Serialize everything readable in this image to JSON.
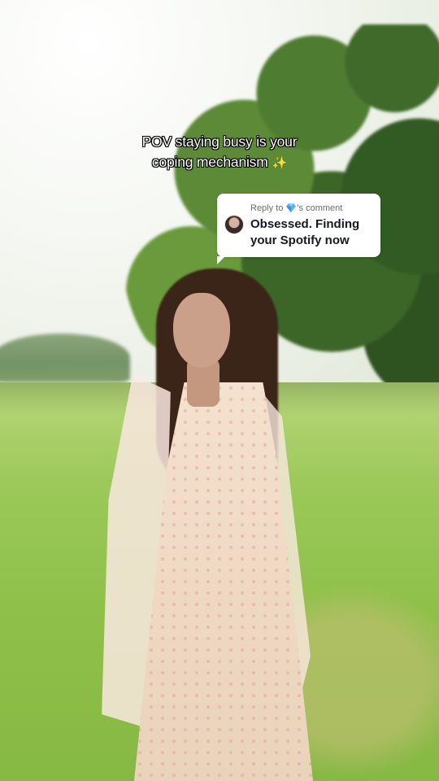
{
  "caption": {
    "line1": "POV staying busy is your",
    "line2": "coping mechanism",
    "emoji": "✨"
  },
  "reply": {
    "prefix": "Reply to",
    "icon": "diamond-icon",
    "suffix": "'s comment",
    "comment": "Obsessed. Finding your Spotify now",
    "avatar_icon": "avatar"
  },
  "colors": {
    "caption_text": "#ffffff",
    "caption_outline": "#000000",
    "reply_bg": "#ffffff",
    "gem": "#5fb0ff"
  }
}
